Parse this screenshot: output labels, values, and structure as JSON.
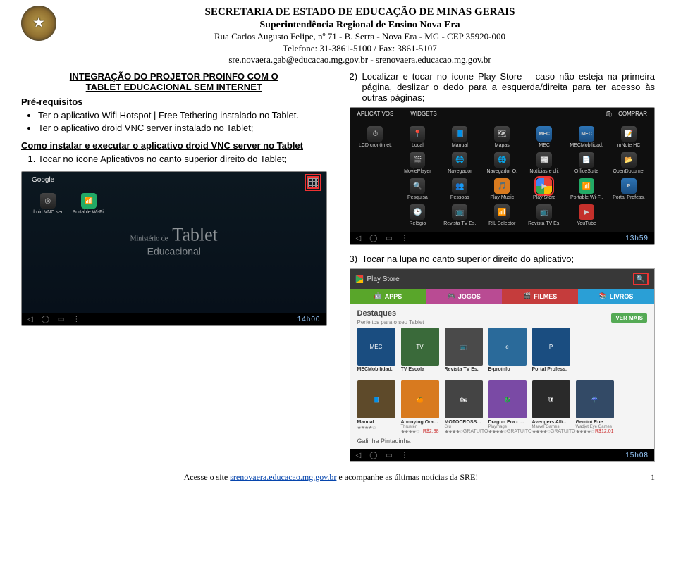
{
  "header": {
    "line1": "SECRETARIA DE ESTADO DE EDUCAÇÃO DE MINAS GERAIS",
    "line2": "Superintendência Regional de Ensino Nova Era",
    "line3": "Rua Carlos Augusto Felipe, nº 71 - B. Serra - Nova Era - MG - CEP 35920-000",
    "line4": "Telefone: 31-3861-5100 / Fax: 3861-5107",
    "line5": "sre.novaera.gab@educacao.mg.gov.br - srenovaera.educacao.mg.gov.br"
  },
  "doc_title_l1": "INTEGRAÇÃO DO PROJETOR PROINFO COM O",
  "doc_title_l2": "TABLET EDUCACIONAL SEM INTERNET",
  "prereq_heading": "Pré-requisitos",
  "prereq_items": [
    "Ter o aplicativo Wifi Hotspot | Free Tethering instalado no Tablet.",
    "Ter o aplicativo droid VNC server instalado no Tablet;"
  ],
  "howto_title": "Como instalar e executar o aplicativo droid VNC server no Tablet",
  "step1": "Tocar no ícone Aplicativos no canto superior direito do Tablet;",
  "step2": "Localizar e tocar no ícone Play Store – caso não esteja na primeira página, deslizar o dedo para a esquerda/direita para ter acesso às outras páginas;",
  "step3": "Tocar na lupa no canto superior direito do aplicativo;",
  "shot_home": {
    "google": "Google",
    "watermark_main": "Tablet",
    "watermark_top": "Ministério de",
    "watermark_sub": "Educacional",
    "icons": [
      "droid VNC ser.",
      "Portable Wi-Fi."
    ],
    "clock": "14h00"
  },
  "shot_apps": {
    "tabs": [
      "APLICATIVOS",
      "WIDGETS"
    ],
    "shop_icon": "COMPRAR",
    "rows": [
      [
        "LCD cronômet.",
        "Local",
        "Manual",
        "Mapas",
        "MEC",
        "MECMobilidad.",
        "mNote HC"
      ],
      [
        "MoviePlayer",
        "Navegador",
        "Navegador O.",
        "Notícias e cli.",
        "OfficeSuite",
        "OpenDocume."
      ],
      [
        "Pesquisa",
        "Pessoas",
        "Play Music",
        "Play Store",
        "Portable Wi-Fi.",
        "Portal Profess."
      ],
      [
        "Relógio",
        "Revista TV Es.",
        "RIL Selector",
        "Revista TV Es.",
        "YouTube"
      ]
    ],
    "highlight": "Play Store",
    "clock": "13h59"
  },
  "shot_store": {
    "top_title": "Play Store",
    "categories": [
      "APPS",
      "JOGOS",
      "FILMES",
      "LIVROS"
    ],
    "section1": {
      "title": "Destaques",
      "subtitle": "Perfeitos para o seu Tablet",
      "btn": "VER MAIS",
      "cards": [
        "MECMobilidad.",
        "TV Escola",
        "Revista TV Es.",
        "E-proinfo",
        "Portal Profess."
      ]
    },
    "section2": {
      "title": "",
      "cards": [
        {
          "title": "Manual",
          "price": "",
          "stars": "★★★★☆"
        },
        {
          "title": "Annoying Orange: Splatter Up!",
          "sub": "Thruster",
          "price": "R$2,38",
          "stars": "★★★★☆"
        },
        {
          "title": "MOTOCROSS MELTDOWN",
          "sub": "Glu",
          "price": "GRATUITO",
          "stars": "★★★★☆"
        },
        {
          "title": "Dragon Era - Slots Card RPG",
          "sub": "Playmage",
          "price": "GRATUITO",
          "stars": "★★★★☆"
        },
        {
          "title": "Avengers Alliance",
          "sub": "Marvel Games",
          "price": "GRATUITO",
          "stars": "★★★★☆"
        },
        {
          "title": "Gemini Rue",
          "sub": "Wadjet Eye Games",
          "price": "R$12,01",
          "stars": "★★★★☆"
        }
      ],
      "bottom_strip": "Galinha Pintadinha"
    },
    "clock": "15h08"
  },
  "footer": {
    "text_before": "Acesse o site ",
    "link": "srenovaera.educacao.mg.gov.br",
    "text_after": " e acompanhe as últimas notícias da SRE!",
    "page_number": "1"
  }
}
